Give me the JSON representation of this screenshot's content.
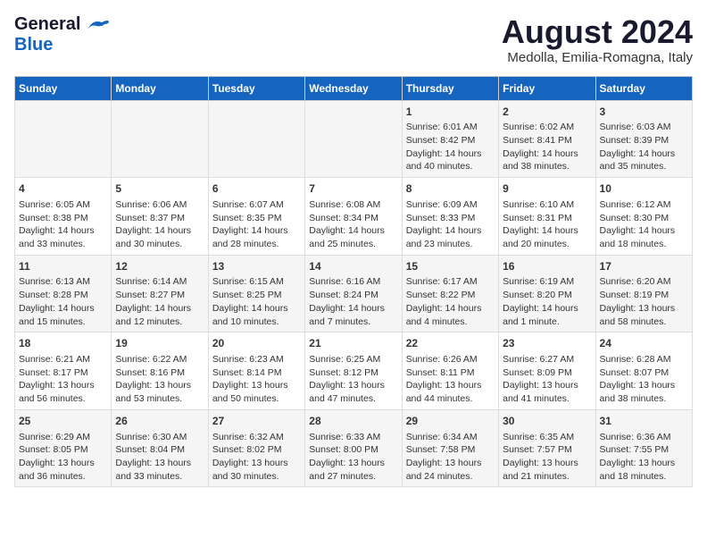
{
  "header": {
    "logo_general": "General",
    "logo_blue": "Blue",
    "main_title": "August 2024",
    "subtitle": "Medolla, Emilia-Romagna, Italy"
  },
  "days_of_week": [
    "Sunday",
    "Monday",
    "Tuesday",
    "Wednesday",
    "Thursday",
    "Friday",
    "Saturday"
  ],
  "weeks": [
    [
      {
        "day": "",
        "content": ""
      },
      {
        "day": "",
        "content": ""
      },
      {
        "day": "",
        "content": ""
      },
      {
        "day": "",
        "content": ""
      },
      {
        "day": "1",
        "content": "Sunrise: 6:01 AM\nSunset: 8:42 PM\nDaylight: 14 hours\nand 40 minutes."
      },
      {
        "day": "2",
        "content": "Sunrise: 6:02 AM\nSunset: 8:41 PM\nDaylight: 14 hours\nand 38 minutes."
      },
      {
        "day": "3",
        "content": "Sunrise: 6:03 AM\nSunset: 8:39 PM\nDaylight: 14 hours\nand 35 minutes."
      }
    ],
    [
      {
        "day": "4",
        "content": "Sunrise: 6:05 AM\nSunset: 8:38 PM\nDaylight: 14 hours\nand 33 minutes."
      },
      {
        "day": "5",
        "content": "Sunrise: 6:06 AM\nSunset: 8:37 PM\nDaylight: 14 hours\nand 30 minutes."
      },
      {
        "day": "6",
        "content": "Sunrise: 6:07 AM\nSunset: 8:35 PM\nDaylight: 14 hours\nand 28 minutes."
      },
      {
        "day": "7",
        "content": "Sunrise: 6:08 AM\nSunset: 8:34 PM\nDaylight: 14 hours\nand 25 minutes."
      },
      {
        "day": "8",
        "content": "Sunrise: 6:09 AM\nSunset: 8:33 PM\nDaylight: 14 hours\nand 23 minutes."
      },
      {
        "day": "9",
        "content": "Sunrise: 6:10 AM\nSunset: 8:31 PM\nDaylight: 14 hours\nand 20 minutes."
      },
      {
        "day": "10",
        "content": "Sunrise: 6:12 AM\nSunset: 8:30 PM\nDaylight: 14 hours\nand 18 minutes."
      }
    ],
    [
      {
        "day": "11",
        "content": "Sunrise: 6:13 AM\nSunset: 8:28 PM\nDaylight: 14 hours\nand 15 minutes."
      },
      {
        "day": "12",
        "content": "Sunrise: 6:14 AM\nSunset: 8:27 PM\nDaylight: 14 hours\nand 12 minutes."
      },
      {
        "day": "13",
        "content": "Sunrise: 6:15 AM\nSunset: 8:25 PM\nDaylight: 14 hours\nand 10 minutes."
      },
      {
        "day": "14",
        "content": "Sunrise: 6:16 AM\nSunset: 8:24 PM\nDaylight: 14 hours\nand 7 minutes."
      },
      {
        "day": "15",
        "content": "Sunrise: 6:17 AM\nSunset: 8:22 PM\nDaylight: 14 hours\nand 4 minutes."
      },
      {
        "day": "16",
        "content": "Sunrise: 6:19 AM\nSunset: 8:20 PM\nDaylight: 14 hours\nand 1 minute."
      },
      {
        "day": "17",
        "content": "Sunrise: 6:20 AM\nSunset: 8:19 PM\nDaylight: 13 hours\nand 58 minutes."
      }
    ],
    [
      {
        "day": "18",
        "content": "Sunrise: 6:21 AM\nSunset: 8:17 PM\nDaylight: 13 hours\nand 56 minutes."
      },
      {
        "day": "19",
        "content": "Sunrise: 6:22 AM\nSunset: 8:16 PM\nDaylight: 13 hours\nand 53 minutes."
      },
      {
        "day": "20",
        "content": "Sunrise: 6:23 AM\nSunset: 8:14 PM\nDaylight: 13 hours\nand 50 minutes."
      },
      {
        "day": "21",
        "content": "Sunrise: 6:25 AM\nSunset: 8:12 PM\nDaylight: 13 hours\nand 47 minutes."
      },
      {
        "day": "22",
        "content": "Sunrise: 6:26 AM\nSunset: 8:11 PM\nDaylight: 13 hours\nand 44 minutes."
      },
      {
        "day": "23",
        "content": "Sunrise: 6:27 AM\nSunset: 8:09 PM\nDaylight: 13 hours\nand 41 minutes."
      },
      {
        "day": "24",
        "content": "Sunrise: 6:28 AM\nSunset: 8:07 PM\nDaylight: 13 hours\nand 38 minutes."
      }
    ],
    [
      {
        "day": "25",
        "content": "Sunrise: 6:29 AM\nSunset: 8:05 PM\nDaylight: 13 hours\nand 36 minutes."
      },
      {
        "day": "26",
        "content": "Sunrise: 6:30 AM\nSunset: 8:04 PM\nDaylight: 13 hours\nand 33 minutes."
      },
      {
        "day": "27",
        "content": "Sunrise: 6:32 AM\nSunset: 8:02 PM\nDaylight: 13 hours\nand 30 minutes."
      },
      {
        "day": "28",
        "content": "Sunrise: 6:33 AM\nSunset: 8:00 PM\nDaylight: 13 hours\nand 27 minutes."
      },
      {
        "day": "29",
        "content": "Sunrise: 6:34 AM\nSunset: 7:58 PM\nDaylight: 13 hours\nand 24 minutes."
      },
      {
        "day": "30",
        "content": "Sunrise: 6:35 AM\nSunset: 7:57 PM\nDaylight: 13 hours\nand 21 minutes."
      },
      {
        "day": "31",
        "content": "Sunrise: 6:36 AM\nSunset: 7:55 PM\nDaylight: 13 hours\nand 18 minutes."
      }
    ]
  ]
}
